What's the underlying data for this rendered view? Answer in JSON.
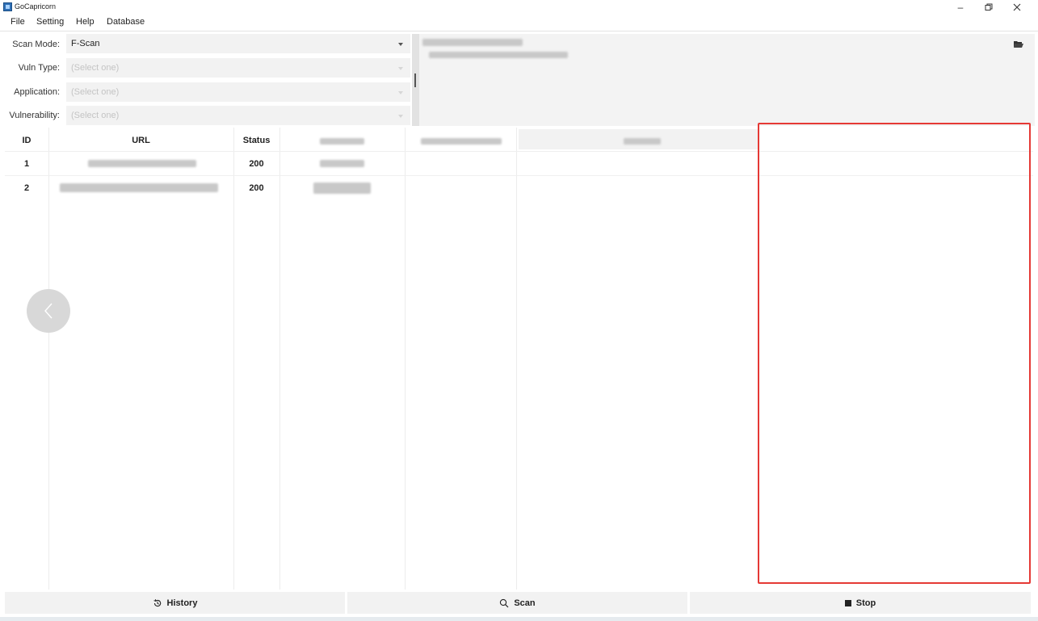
{
  "window": {
    "title": "GoCapricorn",
    "controls": [
      "minimize",
      "restore",
      "close"
    ]
  },
  "menu": [
    "File",
    "Setting",
    "Help",
    "Database"
  ],
  "form": {
    "scan_mode": {
      "label": "Scan Mode:",
      "value": "F-Scan"
    },
    "vuln_type": {
      "label": "Vuln Type:",
      "placeholder": "(Select one)"
    },
    "application": {
      "label": "Application:",
      "placeholder": "(Select one)"
    },
    "vulnerability": {
      "label": "Vulnerability:",
      "placeholder": "(Select one)"
    }
  },
  "table": {
    "headers": [
      "ID",
      "URL",
      "Status"
    ],
    "rows": [
      {
        "id": "1",
        "status": "200"
      },
      {
        "id": "2",
        "status": "200"
      }
    ]
  },
  "buttons": {
    "history": "History",
    "scan": "Scan",
    "stop": "Stop"
  },
  "icons": [
    "app-icon",
    "folder-open-icon",
    "chevron-left-icon",
    "history-icon",
    "search-icon",
    "stop-icon",
    "dropdown-arrow-icon"
  ],
  "colors": {
    "highlight": "#e53935",
    "panel_bg": "#f2f2f2"
  }
}
